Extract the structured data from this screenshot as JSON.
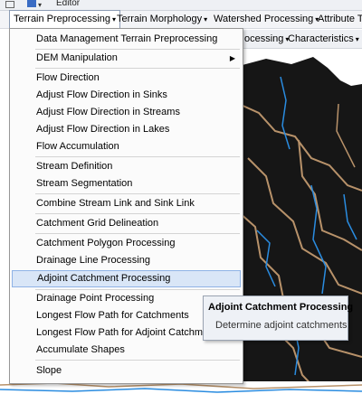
{
  "toolbar": {
    "editor_label": "Editor"
  },
  "menubar": {
    "items": [
      {
        "label": "Terrain Preprocessing"
      },
      {
        "label": "Terrain Morphology"
      },
      {
        "label": "Watershed Processing"
      },
      {
        "label": "Attribute T"
      }
    ]
  },
  "subbar": {
    "items": [
      {
        "label": "ocessing"
      },
      {
        "label": "Characteristics"
      }
    ]
  },
  "menu": {
    "items": [
      {
        "label": "Data Management Terrain Preprocessing"
      },
      {
        "label": "DEM Manipulation"
      },
      {
        "label": "Flow Direction"
      },
      {
        "label": "Adjust Flow Direction in Sinks"
      },
      {
        "label": "Adjust Flow Direction in Streams"
      },
      {
        "label": "Adjust Flow Direction in Lakes"
      },
      {
        "label": "Flow Accumulation"
      },
      {
        "label": "Stream Definition"
      },
      {
        "label": "Stream Segmentation"
      },
      {
        "label": "Combine Stream Link and Sink Link"
      },
      {
        "label": "Catchment Grid Delineation"
      },
      {
        "label": "Catchment Polygon Processing"
      },
      {
        "label": "Drainage Line Processing"
      },
      {
        "label": "Adjoint Catchment Processing"
      },
      {
        "label": "Drainage Point Processing"
      },
      {
        "label": "Longest Flow Path for Catchments"
      },
      {
        "label": "Longest Flow Path for Adjoint Catchme"
      },
      {
        "label": "Accumulate Shapes"
      },
      {
        "label": "Slope"
      }
    ]
  },
  "tooltip": {
    "title": "Adjoint Catchment Processing",
    "description": "Determine adjoint catchments"
  },
  "colors": {
    "highlight_bg": "#d9e6f7",
    "highlight_border": "#8fb3e6",
    "map_dark": "#161616",
    "catchment_outline": "#b8926a",
    "stream_blue": "#2a8ce0"
  }
}
